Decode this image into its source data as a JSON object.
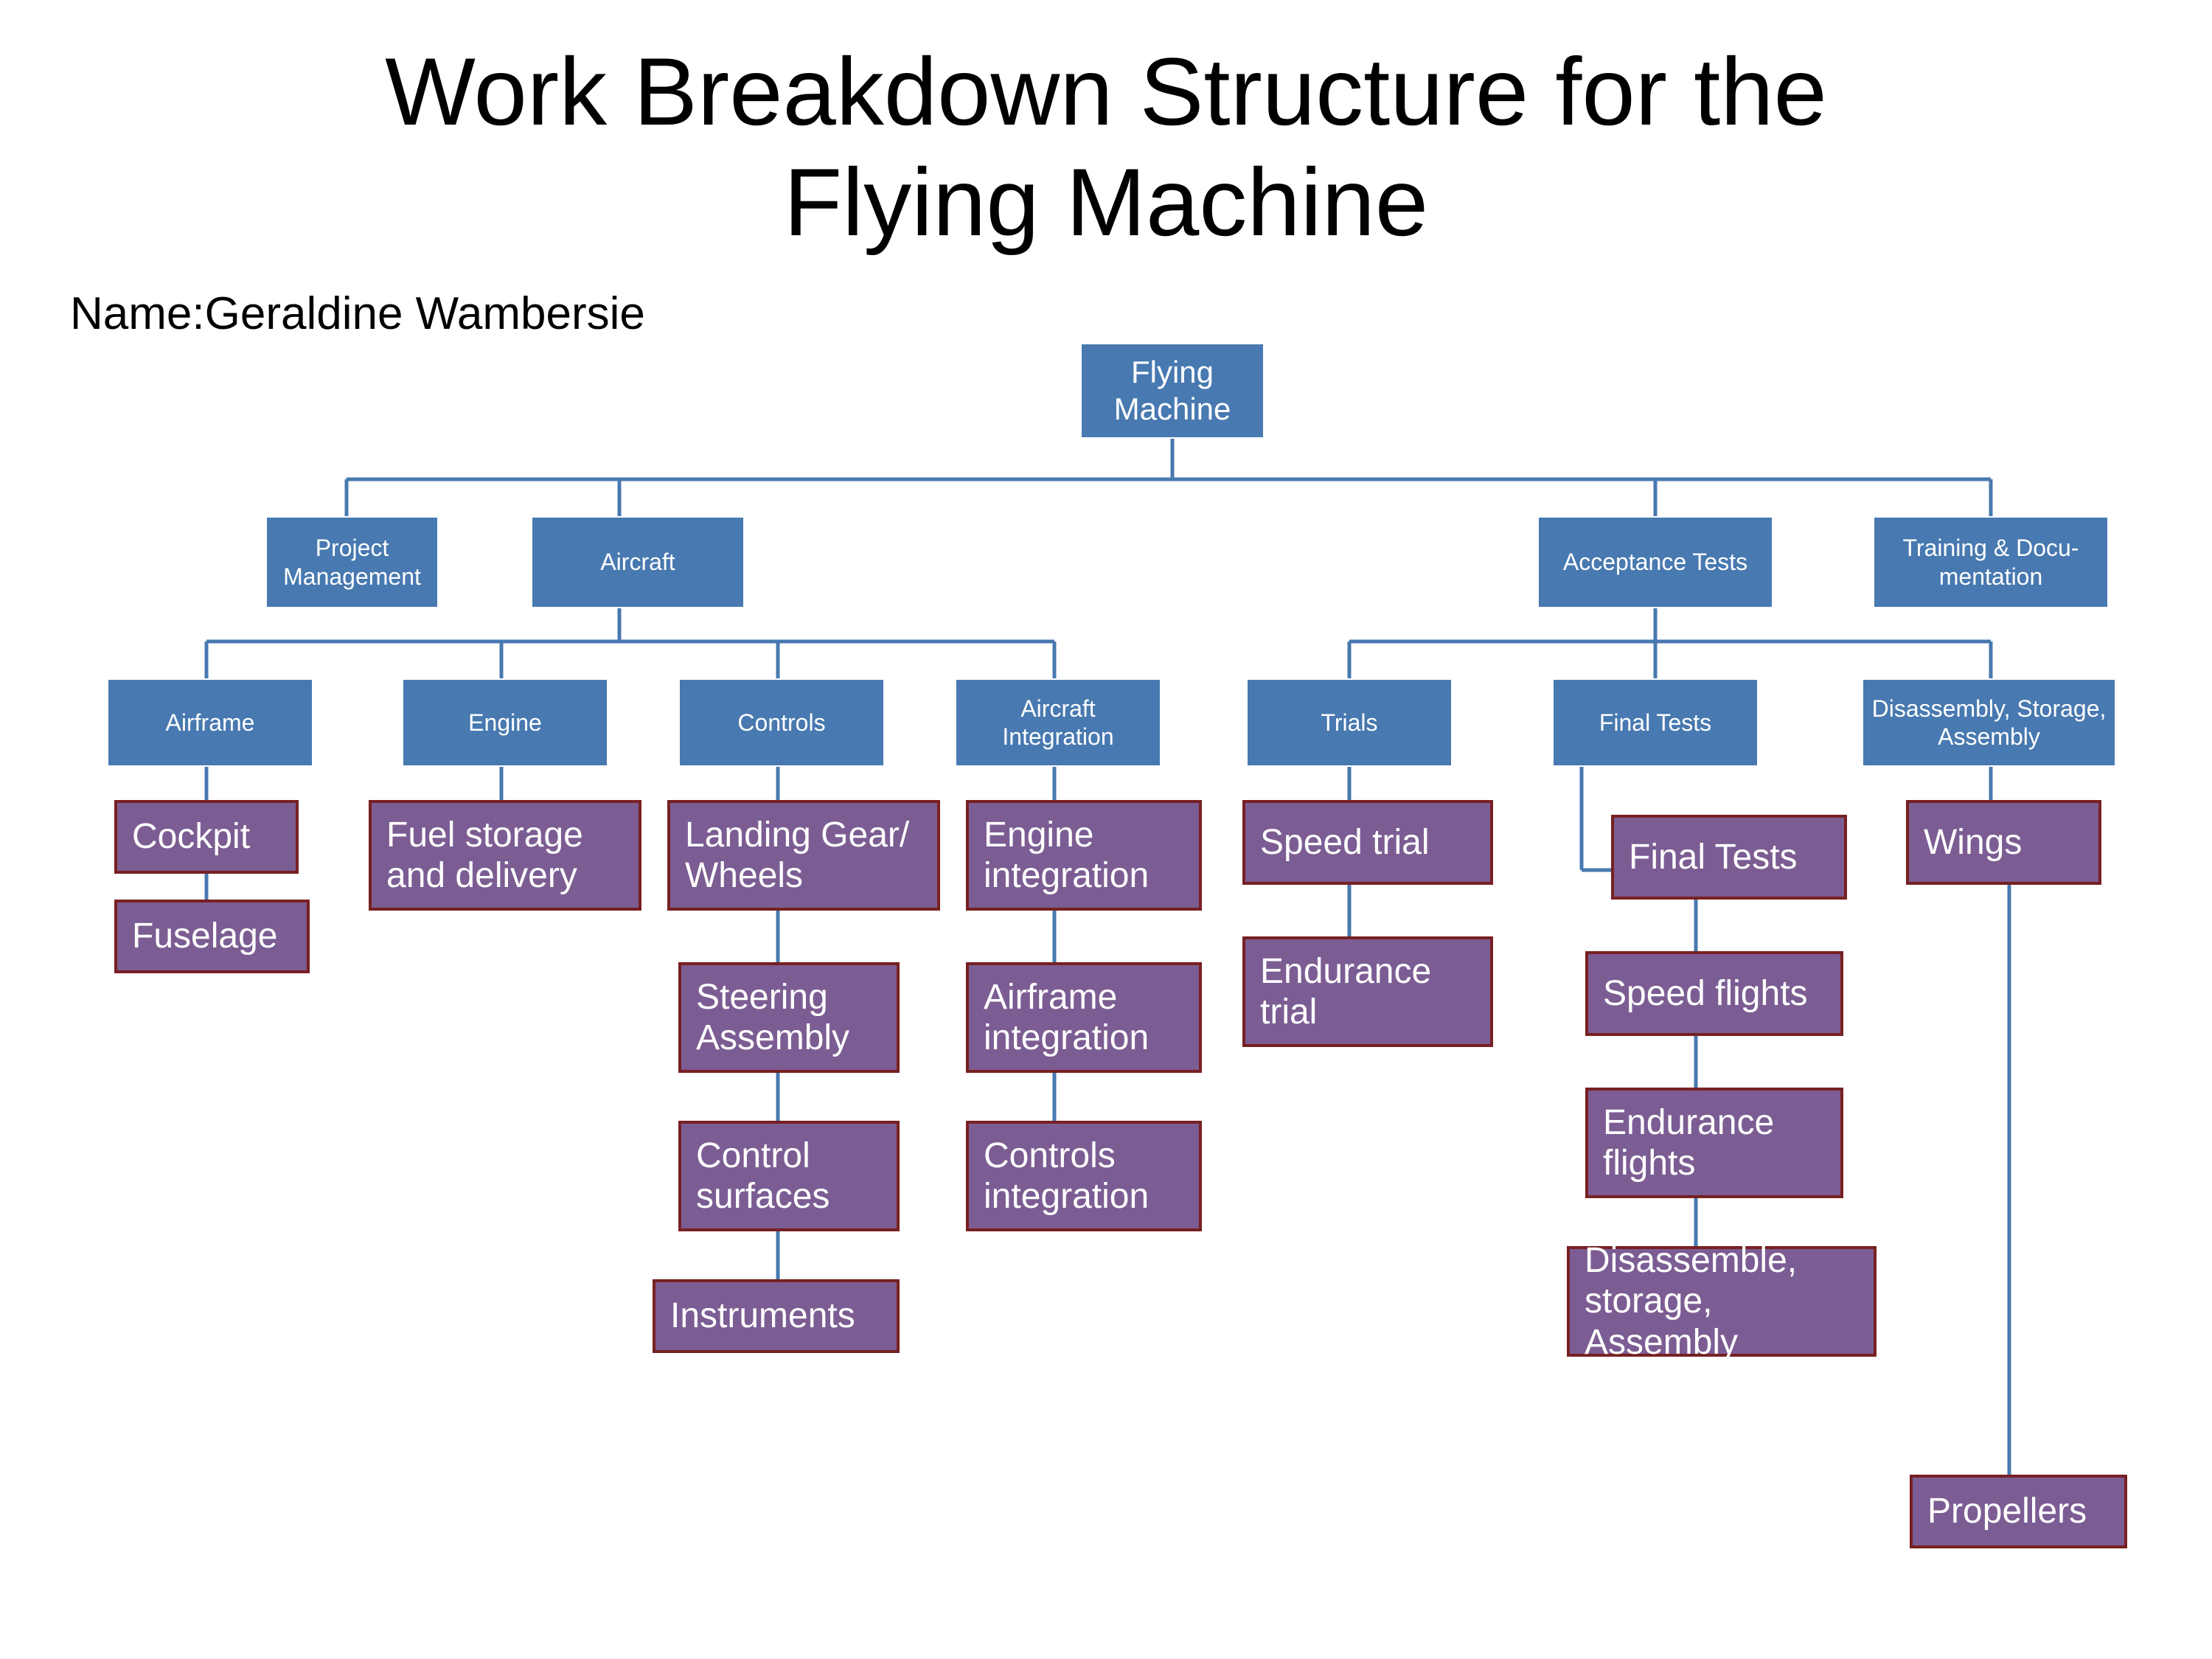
{
  "title_line1": "Work Breakdown Structure for the",
  "title_line2": "Flying Machine",
  "author": "Name:Geraldine Wambersie",
  "root": "Flying Machine",
  "level1": {
    "pm": "Project Management",
    "aircraft": "Aircraft",
    "tests": "Acceptance Tests",
    "training": "Training & Docu-mentation"
  },
  "level2": {
    "airframe": "Airframe",
    "engine": "Engine",
    "controls": "Controls",
    "aint": "Aircraft Integration",
    "trials": "Trials",
    "final": "Final Tests",
    "dsa": "Disassembly, Storage, Assembly"
  },
  "purple": {
    "cockpit": "Cockpit",
    "fuselage": "Fuselage",
    "fuel": "Fuel storage and delivery",
    "landing": "Landing Gear/ Wheels",
    "steering": "Steering Assembly",
    "csurf": "Control surfaces",
    "instr": "Instruments",
    "eint": "Engine integration",
    "afint": "Airframe integration",
    "cint": "Controls integration",
    "speedt": "Speed trial",
    "endt": "Endurance trial",
    "ftests": "Final Tests",
    "sflights": "Speed flights",
    "eflights": "Endurance flights",
    "dsa2": "Disassemble, storage, Assembly",
    "wings": "Wings",
    "propellers": "Propellers"
  }
}
